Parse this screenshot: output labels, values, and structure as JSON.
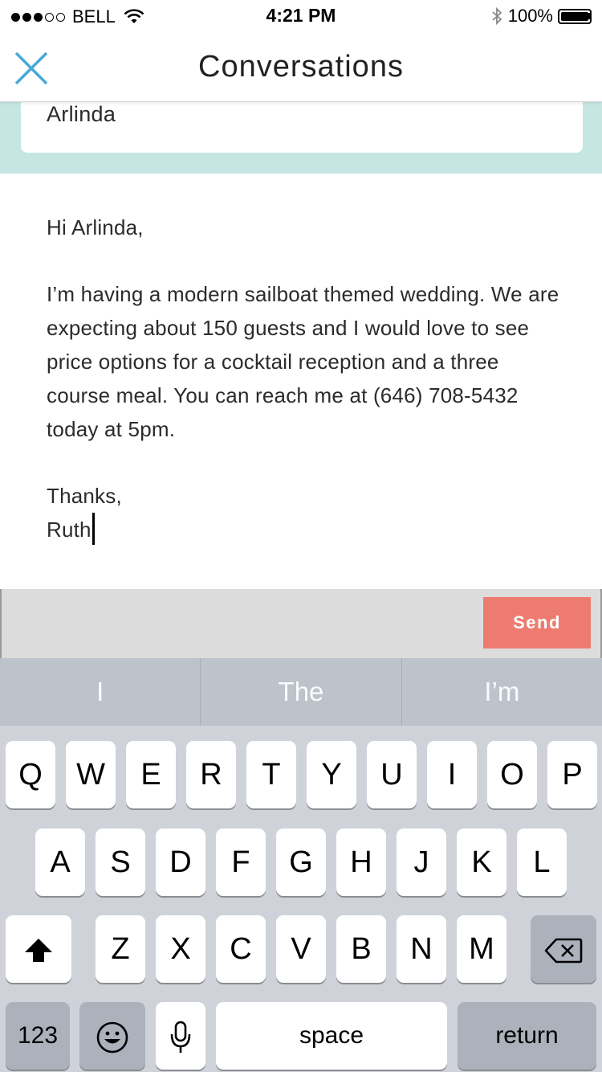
{
  "status_bar": {
    "carrier": "BELL",
    "time": "4:21 PM",
    "battery": "100%",
    "signal_bars": 3,
    "battery_level": 1.0
  },
  "header": {
    "title": "Conversations",
    "close_icon": "close-icon",
    "accent": "#4aa8d8"
  },
  "recipient": {
    "name": "Arlinda",
    "band_color": "#c6e6e4"
  },
  "message": {
    "greeting": "Hi Arlinda,",
    "body": "I’m having a modern sailboat themed wedding. We are expecting about 150 guests and I would love to see price options for a cocktail reception and a three course meal. You can reach me at (646) 708-5432 today at 5pm.",
    "signoff": "Thanks,",
    "signature": "Ruth"
  },
  "send_bar": {
    "send_label": "Send",
    "send_color": "#ee7b6f"
  },
  "keyboard": {
    "predictions": [
      "I",
      "The",
      "I’m"
    ],
    "row1": [
      "Q",
      "W",
      "E",
      "R",
      "T",
      "Y",
      "U",
      "I",
      "O",
      "P"
    ],
    "row2": [
      "A",
      "S",
      "D",
      "F",
      "G",
      "H",
      "J",
      "K",
      "L"
    ],
    "row3": [
      "Z",
      "X",
      "C",
      "V",
      "B",
      "N",
      "M"
    ],
    "numbers_label": "123",
    "space_label": "space",
    "return_label": "return",
    "shift_icon": "shift-icon",
    "delete_icon": "delete-icon",
    "emoji_icon": "emoji-icon",
    "mic_icon": "microphone-icon"
  }
}
